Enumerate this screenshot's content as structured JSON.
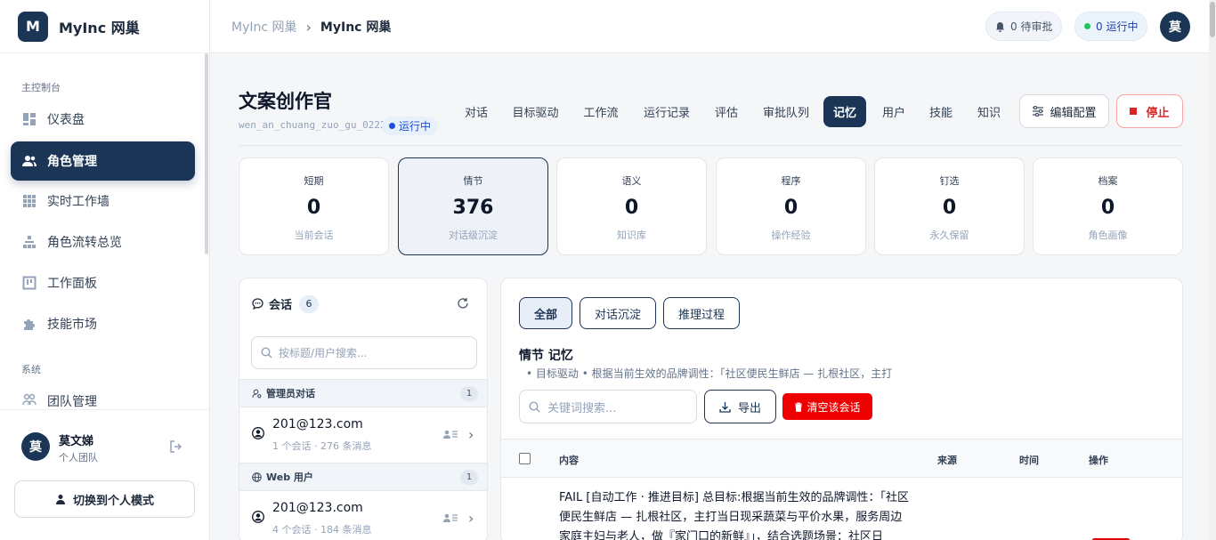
{
  "app": {
    "logo_letter": "M",
    "name": "MyInc 网巢"
  },
  "sidebar": {
    "section_main": "主控制台",
    "section_system": "系统",
    "items": [
      {
        "label": "仪表盘",
        "icon": "dashboard-icon"
      },
      {
        "label": "角色管理",
        "icon": "users-icon"
      },
      {
        "label": "实时工作墙",
        "icon": "grid-icon"
      },
      {
        "label": "角色流转总览",
        "icon": "hierarchy-icon"
      },
      {
        "label": "工作面板",
        "icon": "board-icon"
      },
      {
        "label": "技能市场",
        "icon": "puzzle-icon"
      },
      {
        "label": "团队管理",
        "icon": "team-icon"
      }
    ],
    "user": {
      "avatar": "莫",
      "name": "莫文娣",
      "team": "个人团队"
    },
    "switch_label": "切换到个人模式"
  },
  "header": {
    "breadcrumb": [
      "MyInc 网巢",
      "MyInc 网巢"
    ],
    "pending": "0 待审批",
    "running": "0 运行中",
    "avatar": "莫"
  },
  "agent": {
    "title": "文案创作官",
    "id": "wen_an_chuang_zuo_gu_0222",
    "status": "运行中",
    "tabs": [
      "对话",
      "目标驱动",
      "工作流",
      "运行记录",
      "评估",
      "审批队列",
      "记忆",
      "用户",
      "技能",
      "知识"
    ],
    "active_tab": "记忆",
    "edit_label": "编辑配置",
    "stop_label": "停止"
  },
  "stats": [
    {
      "label": "短期",
      "value": "0",
      "sub": "当前会话"
    },
    {
      "label": "情节",
      "value": "376",
      "sub": "对话级沉淀"
    },
    {
      "label": "语义",
      "value": "0",
      "sub": "知识库"
    },
    {
      "label": "程序",
      "value": "0",
      "sub": "操作经验"
    },
    {
      "label": "钉选",
      "value": "0",
      "sub": "永久保留"
    },
    {
      "label": "档案",
      "value": "0",
      "sub": "角色画像"
    }
  ],
  "sessions": {
    "title": "会话",
    "count": "6",
    "search_placeholder": "按标题/用户搜索...",
    "groups": [
      {
        "name": "管理员对话",
        "count": "1",
        "items": [
          {
            "email": "201@123.com",
            "meta": "1 个会话 · 276 条消息"
          }
        ]
      },
      {
        "name": "Web 用户",
        "count": "1",
        "items": [
          {
            "email": "201@123.com",
            "meta": "4 个会话 · 184 条消息"
          }
        ]
      }
    ]
  },
  "memory": {
    "filters": [
      "全部",
      "对话沉淀",
      "推理过程"
    ],
    "title": "情节 记忆",
    "subtitle": "• 目标驱动 • 根据当前生效的品牌调性：「社区便民生鲜店 — 扎根社区，主打",
    "search_placeholder": "关键词搜索...",
    "export_label": "导出",
    "clear_label": "清空该会话",
    "columns": [
      "内容",
      "来源",
      "时间",
      "操作"
    ],
    "rows": [
      {
        "content": "FAIL [自动工作 · 推进目标] 总目标:根据当前生效的品牌调性：「社区便民生鲜店 — 扎根社区，主打当日现采蔬菜与平价水果，服务周边家庭主妇与老人，做『家门口的新鲜』」，结合选题场景：社区日"
      }
    ]
  },
  "colors": {
    "primary": "#1b3556",
    "danger": "#ef0000",
    "running": "#22c55e"
  }
}
